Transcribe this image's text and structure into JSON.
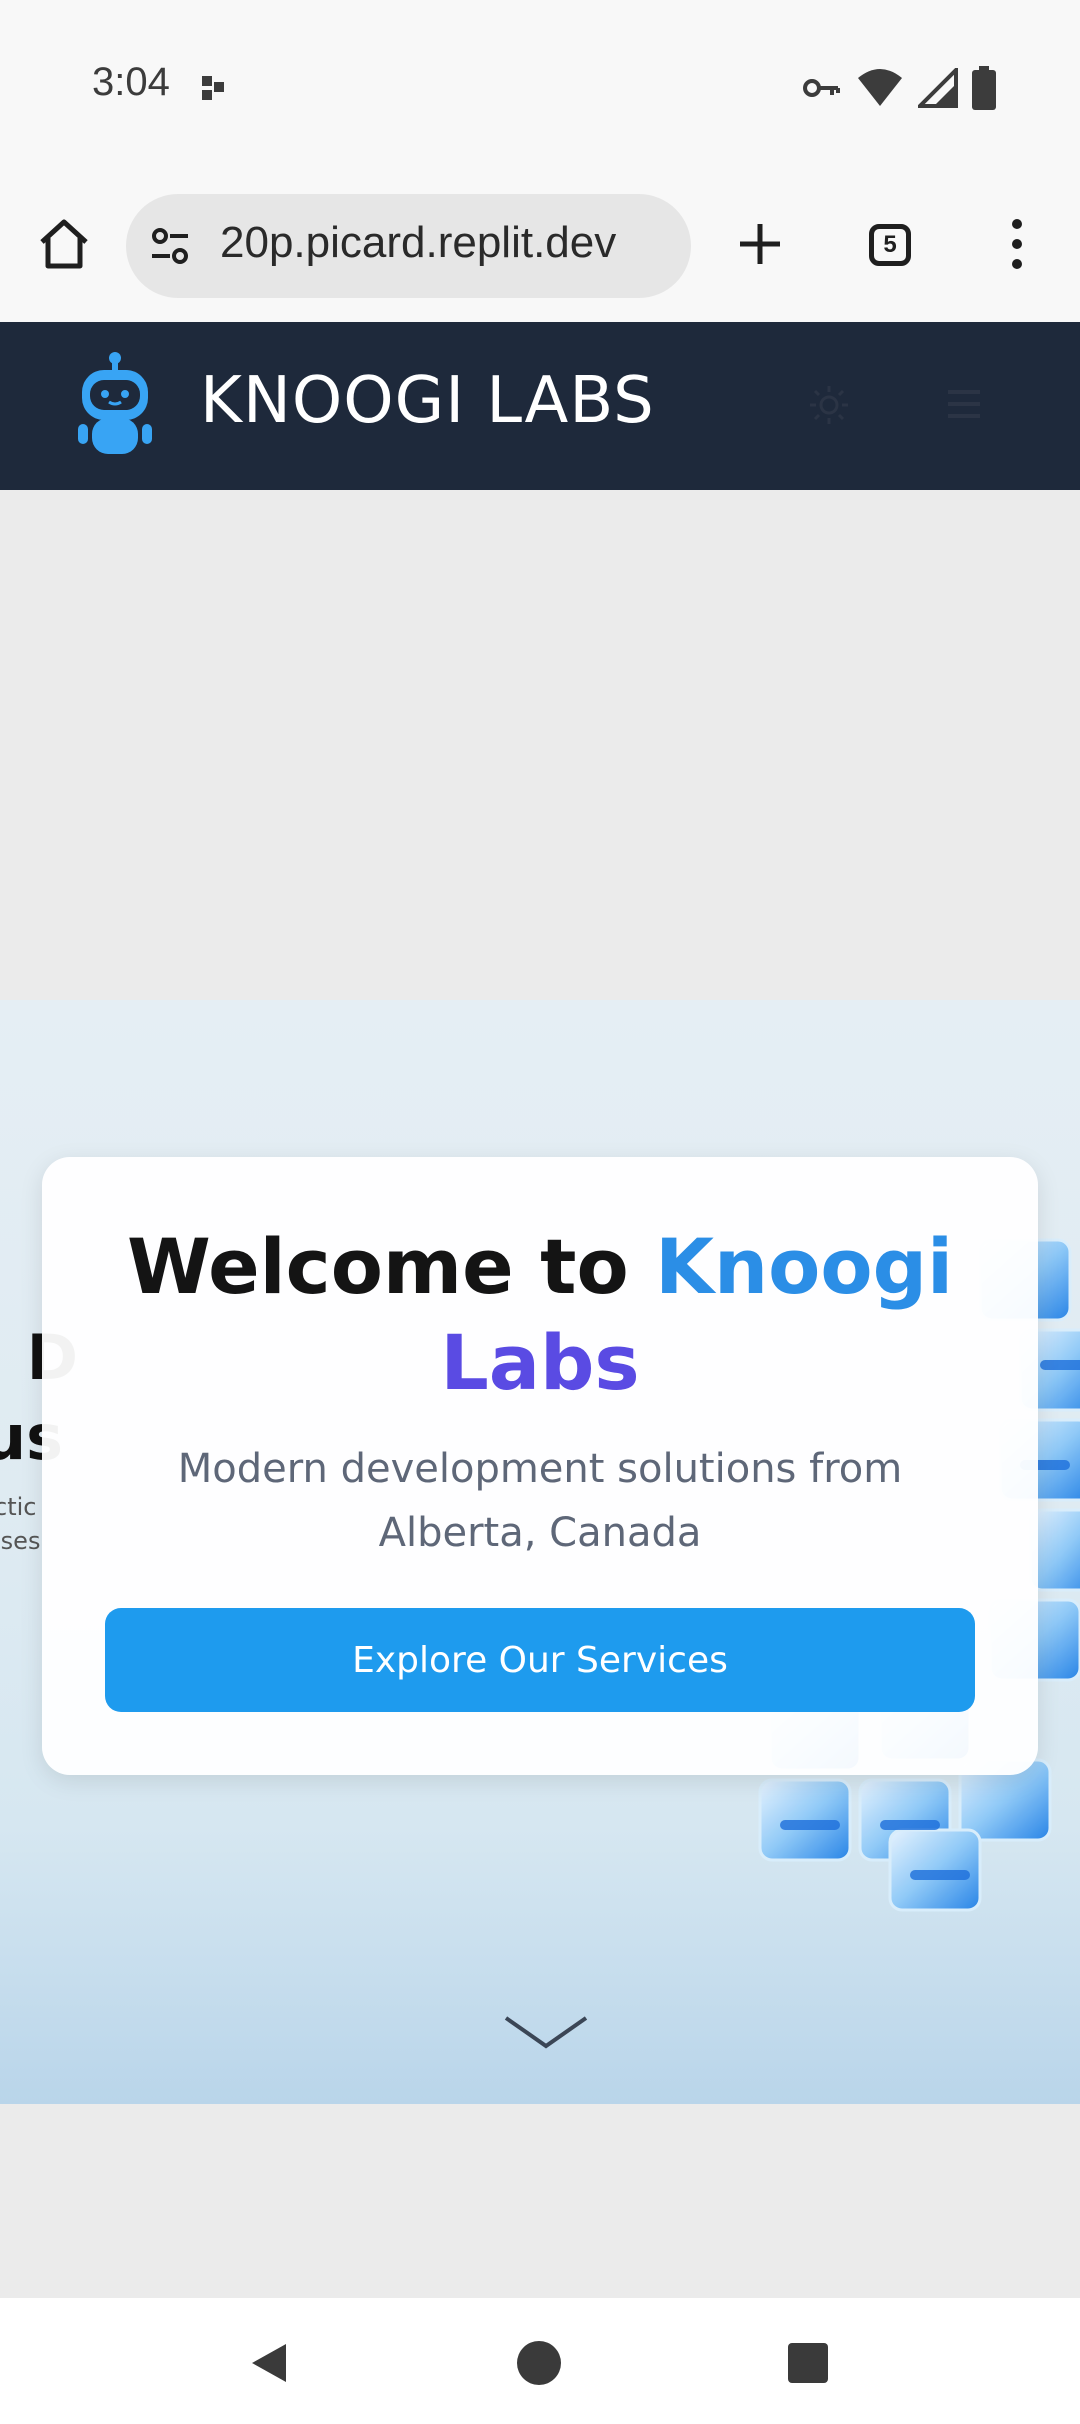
{
  "status_bar": {
    "time": "3:04",
    "icons": [
      "notification-dots-icon",
      "vpn-key-icon",
      "wifi-icon",
      "cell-signal-icon",
      "battery-icon"
    ]
  },
  "browser": {
    "url": "20p.picard.replit.dev",
    "tab_count": "5",
    "icons": [
      "home-icon",
      "site-settings-icon",
      "new-tab-icon",
      "tab-switcher-icon",
      "more-options-icon"
    ]
  },
  "site_header": {
    "brand": "KNOOGI LABS",
    "icons": [
      "robot-logo-icon",
      "sun-icon",
      "hamburger-menu-icon"
    ]
  },
  "hero": {
    "title_prefix": "Welcome to ",
    "title_accent_1": "Knoogi",
    "title_accent_2": "Labs",
    "subtitle": "Modern development solutions from Alberta, Canada",
    "cta_label": "Explore Our Services",
    "background_text_line1": "I D",
    "background_text_line2": "us",
    "background_small_line1": "ctic",
    "background_small_line2": "ises",
    "icons": [
      "chevron-down-icon"
    ]
  },
  "nav_bar": {
    "icons": [
      "back-icon",
      "home-circle-icon",
      "recents-icon"
    ]
  },
  "colors": {
    "header_bg": "#1e293b",
    "accent_blue": "#2b8ee6",
    "accent_purple": "#5a4be3",
    "cta_bg": "#1e9bee"
  }
}
